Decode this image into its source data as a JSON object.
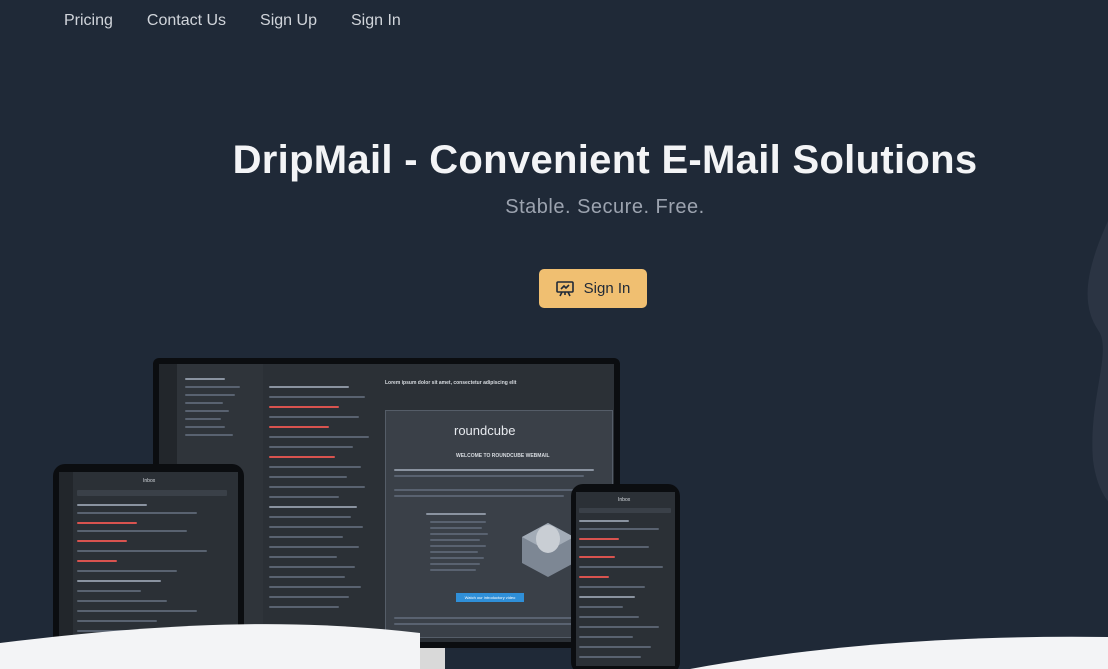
{
  "nav": {
    "items": [
      "Pricing",
      "Contact Us",
      "Sign Up",
      "Sign In"
    ]
  },
  "hero": {
    "title": "DripMail - Convenient E-Mail Solutions",
    "subtitle": "Stable. Secure. Free.",
    "cta_label": "Sign In",
    "cta_icon": "presentation-icon"
  },
  "preview": {
    "email_subject": "Lorem ipsum dolor sit amet, consectetur adipiscing elit",
    "logo": "roundcube",
    "welcome": "WELCOME TO ROUNDCUBE WEBMAIL",
    "watch_button": "Watch our introductory video",
    "inbox_label": "Inbox"
  },
  "colors": {
    "background": "#1f2937",
    "cta": "#f0bf71",
    "text": "#e5e7eb",
    "muted": "#9ca3af"
  }
}
